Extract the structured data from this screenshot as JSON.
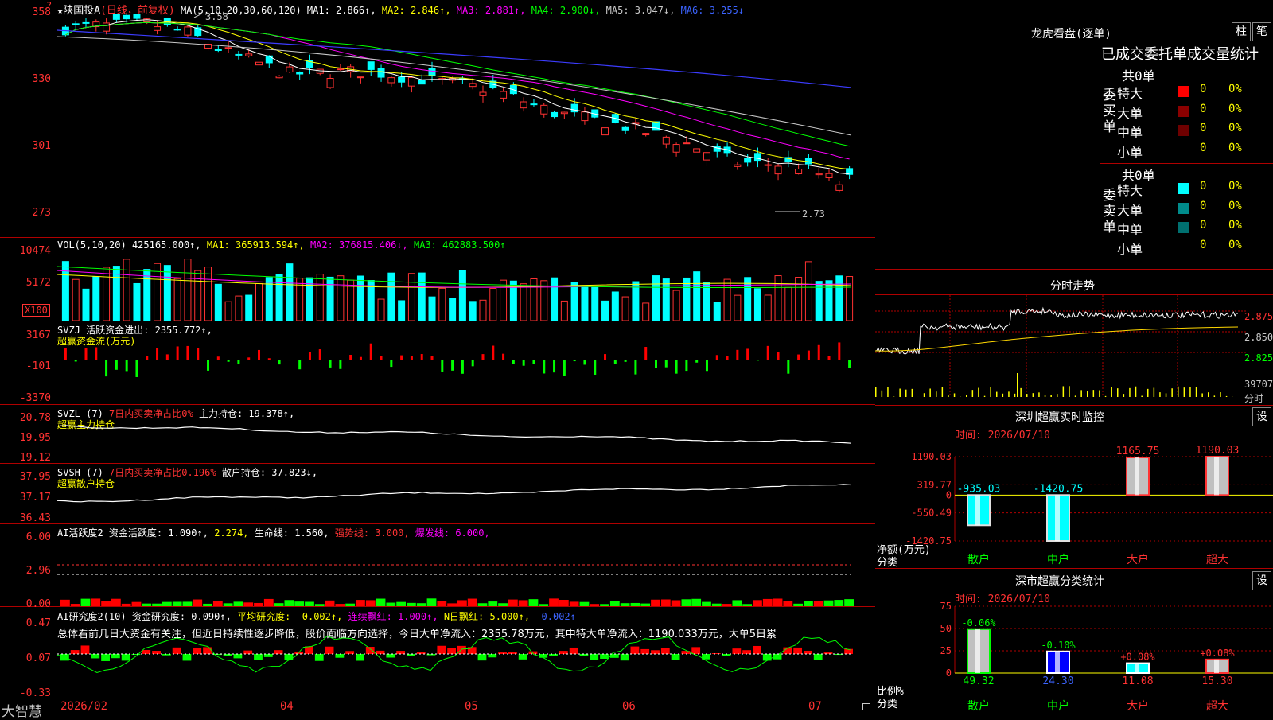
{
  "app": {
    "brand": "大智慧"
  },
  "main": {
    "header": {
      "star": "★",
      "name": "陕国投A",
      "mode": "(日线，前复权)",
      "ma_label": "MA(5,10,20,30,60,120)",
      "ma1": "MA1: 2.866↑,",
      "ma2": "MA2: 2.846↑,",
      "ma3": "MA3: 2.881↑,",
      "ma4": "MA4: 2.900↓,",
      "ma5": "MA5: 3.047↓,",
      "ma6": "MA6: 3.255↓"
    },
    "y_ticks": [
      "358",
      "330",
      "301",
      "273"
    ],
    "hi_label": "3.58",
    "lo_label": "2.73",
    "corner": "?"
  },
  "vol": {
    "header": {
      "label": "VOL(5,10,20)",
      "value": "425165.000↑,",
      "ma1": "MA1: 365913.594↑,",
      "ma2": "MA2: 376815.406↓,",
      "ma3": "MA3: 462883.500↑"
    },
    "y_ticks": [
      "10474",
      "5172"
    ],
    "unit": "X100"
  },
  "svzj": {
    "header": {
      "label": "SVZJ",
      "title": "活跃资金进出: 2355.772↑,",
      "sub": "超赢资金流(万元)"
    },
    "y_ticks": [
      "3167",
      "-101",
      "-3370"
    ]
  },
  "svzl": {
    "header": {
      "label": "SVZL (7)",
      "red": "7日内买卖净占比0%",
      "value": "主力持仓: 19.378↑,",
      "sub": "超赢主力持仓"
    },
    "y_ticks": [
      "20.78",
      "19.95",
      "19.12"
    ]
  },
  "svsh": {
    "header": {
      "label": "SVSH (7)",
      "red": "7日内买卖净占比0.196%",
      "value": "散户持仓: 37.823↓,",
      "sub": "超赢散户持仓"
    },
    "y_ticks": [
      "37.95",
      "37.17",
      "36.43"
    ]
  },
  "ai1": {
    "header": {
      "label": "AI活跃度2",
      "v1": "资金活跃度: 1.090↑,",
      "v2": "2.274,",
      "v3": "生命线: 1.560,",
      "v4": "强势线: 3.000,",
      "v5": "爆发线: 6.000,"
    },
    "y_ticks": [
      "6.00",
      "2.96",
      "0.00"
    ]
  },
  "ai2": {
    "header": {
      "label": "AI研究度2(10)",
      "v1": "资金研究度: 0.090↑,",
      "v2": "平均研究度: -0.002↑,",
      "v3": "连续飘红: 1.000↑,",
      "v4": "N日飘红: 5.000↑,",
      "v5": "-0.002↑"
    },
    "text": "总体看前几日大资金有关注，但近日持续性逐步降低，股价面临方向选择，今日大单净流入：2355.78万元，其中特大单净流入：1190.033万元，大单5日累",
    "y_ticks": [
      "0.47",
      "0.07",
      "-0.33"
    ]
  },
  "x_axis": {
    "ticks": [
      "2026/02",
      "04",
      "05",
      "06",
      "07"
    ]
  },
  "right": {
    "lhb": {
      "title": "龙虎看盘(逐单)",
      "btn1": "柱",
      "btn2": "笔",
      "subtitle": "已成交委托单成交量统计",
      "buy": {
        "side": "委买单",
        "total": "共0单",
        "rows": [
          {
            "label": "特大",
            "n": "0",
            "pct": "0%",
            "color": "#ff0000"
          },
          {
            "label": "大单",
            "n": "0",
            "pct": "0%",
            "color": "#8b0000"
          },
          {
            "label": "中单",
            "n": "0",
            "pct": "0%",
            "color": "#6e0000"
          },
          {
            "label": "小单",
            "n": "0",
            "pct": "0%",
            "color": "#000000"
          }
        ]
      },
      "sell": {
        "side": "委卖单",
        "total": "共0单",
        "rows": [
          {
            "label": "特大",
            "n": "0",
            "pct": "0%",
            "color": "#00ffff"
          },
          {
            "label": "大单",
            "n": "0",
            "pct": "0%",
            "color": "#008b8b"
          },
          {
            "label": "中单",
            "n": "0",
            "pct": "0%",
            "color": "#007070"
          },
          {
            "label": "小单",
            "n": "0",
            "pct": "0%",
            "color": "#000000"
          }
        ]
      }
    },
    "intraday": {
      "title": "分时走势",
      "prices": [
        "2.875",
        "2.850",
        "2.825"
      ],
      "vol_label": "39707",
      "vol_unit": "分时"
    },
    "sz_monitor": {
      "title": "深圳超赢实时监控",
      "btn": "设",
      "time": "时间: 2026/07/10",
      "ylabel": "净额(万元)",
      "xlabel": "分类"
    },
    "sz_class": {
      "title": "深市超赢分类统计",
      "btn": "设",
      "time": "时间: 2026/07/10",
      "ylabel": "比例%",
      "xlabel": "分类"
    }
  },
  "chart_data": [
    {
      "type": "bar",
      "title": "深圳超赢实时监控",
      "categories": [
        "散户",
        "中户",
        "大户",
        "超大"
      ],
      "values": [
        -935.03,
        -1420.75,
        1165.75,
        1190.03
      ],
      "y_ticks": [
        1190.03,
        319.77,
        0,
        -550.49,
        -1420.75
      ],
      "ylim": [
        -1420.75,
        1190.03
      ],
      "ylabel": "净额(万元)",
      "xlabel": "分类"
    },
    {
      "type": "bar",
      "title": "深市超赢分类统计",
      "categories": [
        "散户",
        "中户",
        "大户",
        "超大"
      ],
      "values": [
        49.32,
        24.3,
        11.08,
        15.3
      ],
      "value_labels": [
        "49.32",
        "24.30",
        "11.08",
        "15.30"
      ],
      "changes": [
        "-0.06%",
        "-0.10%",
        "+0.08%",
        "+0.08%"
      ],
      "y_ticks": [
        75,
        50,
        25,
        0
      ],
      "ylim": [
        0,
        75
      ],
      "ylabel": "比例%",
      "xlabel": "分类"
    }
  ]
}
